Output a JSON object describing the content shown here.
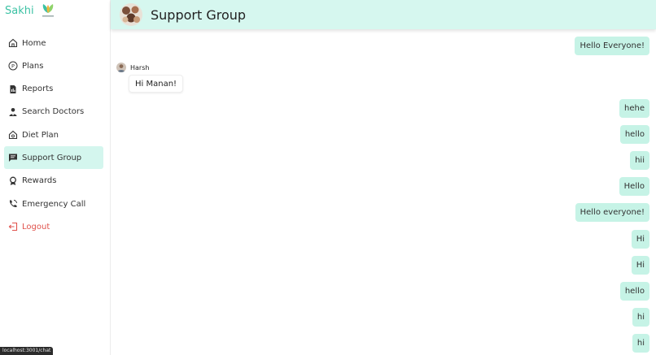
{
  "brand": {
    "name": "Sakhi",
    "color": "#3cc2a4"
  },
  "sidebar": {
    "items": [
      {
        "label": "Home",
        "icon": "home-icon"
      },
      {
        "label": "Plans",
        "icon": "plans-icon"
      },
      {
        "label": "Reports",
        "icon": "report-icon"
      },
      {
        "label": "Search Doctors",
        "icon": "doctor-icon"
      },
      {
        "label": "Diet Plan",
        "icon": "diet-icon"
      },
      {
        "label": "Support Group",
        "icon": "chat-icon",
        "active": true
      },
      {
        "label": "Rewards",
        "icon": "award-icon"
      },
      {
        "label": "Emergency Call",
        "icon": "phone-icon"
      },
      {
        "label": "Logout",
        "icon": "logout-icon",
        "color": "#e0524c"
      }
    ]
  },
  "header": {
    "title": "Support Group"
  },
  "chat": {
    "messages": [
      {
        "text": "Hello Everyone!",
        "direction": "out"
      },
      {
        "sender": "Harsh",
        "text": "Hi Manan!",
        "direction": "in"
      },
      {
        "text": "hehe",
        "direction": "out"
      },
      {
        "text": "hello",
        "direction": "out"
      },
      {
        "text": "hii",
        "direction": "out"
      },
      {
        "text": "Hello",
        "direction": "out"
      },
      {
        "text": "Hello everyone!",
        "direction": "out"
      },
      {
        "text": "Hi",
        "direction": "out"
      },
      {
        "text": "Hi",
        "direction": "out"
      },
      {
        "text": "hello",
        "direction": "out"
      },
      {
        "text": "hi",
        "direction": "out"
      },
      {
        "text": "hi",
        "direction": "out"
      }
    ]
  },
  "status_bar": {
    "url": "localhost:3001/chat"
  },
  "colors": {
    "accent": "#c6f3e6",
    "header_bg": "#d6f7ef",
    "active_nav": "#d4f6ee"
  }
}
